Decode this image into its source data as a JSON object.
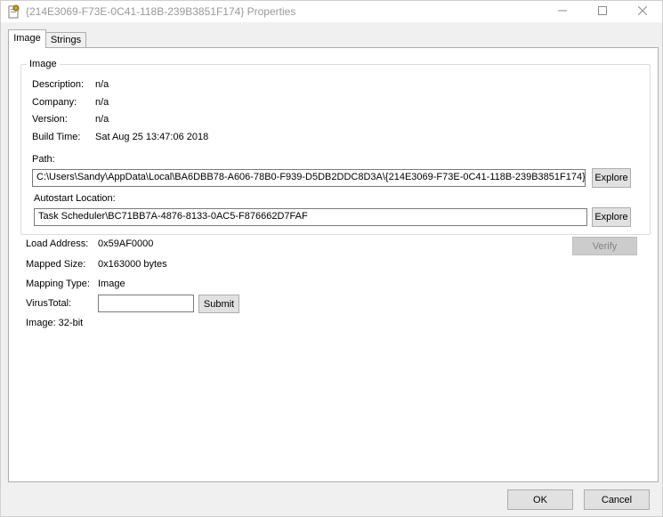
{
  "window": {
    "title": "{214E3069-F73E-0C41-118B-239B3851F174} Properties"
  },
  "tabs": [
    {
      "label": "Image",
      "active": true
    },
    {
      "label": "Strings",
      "active": false
    }
  ],
  "image_group": {
    "title": "Image",
    "description_label": "Description:",
    "description_value": "n/a",
    "company_label": "Company:",
    "company_value": "n/a",
    "version_label": "Version:",
    "version_value": "n/a",
    "build_time_label": "Build Time:",
    "build_time_value": "Sat Aug 25 13:47:06 2018",
    "path_label": "Path:",
    "path_value": "C:\\Users\\Sandy\\AppData\\Local\\BA6DBB78-A606-78B0-F939-D5DB2DDC8D3A\\{214E3069-F73E-0C41-118B-239B3851F174}",
    "path_explore_label": "Explore",
    "autostart_label": "Autostart Location:",
    "autostart_value": "Task Scheduler\\BC71BB7A-4876-8133-0AC5-F876662D7FAF",
    "autostart_explore_label": "Explore"
  },
  "details": {
    "load_address_label": "Load Address:",
    "load_address_value": "0x59AF0000",
    "verify_label": "Verify",
    "mapped_size_label": "Mapped Size:",
    "mapped_size_value": "0x163000 bytes",
    "mapping_type_label": "Mapping Type:",
    "mapping_type_value": "Image",
    "virustotal_label": "VirusTotal:",
    "virustotal_value": "",
    "submit_label": "Submit",
    "bitness": "Image: 32-bit"
  },
  "footer": {
    "ok_label": "OK",
    "cancel_label": "Cancel"
  },
  "icons": {
    "app": "app-icon",
    "minimize": "minimize-icon",
    "maximize": "maximize-icon",
    "close": "close-icon"
  }
}
